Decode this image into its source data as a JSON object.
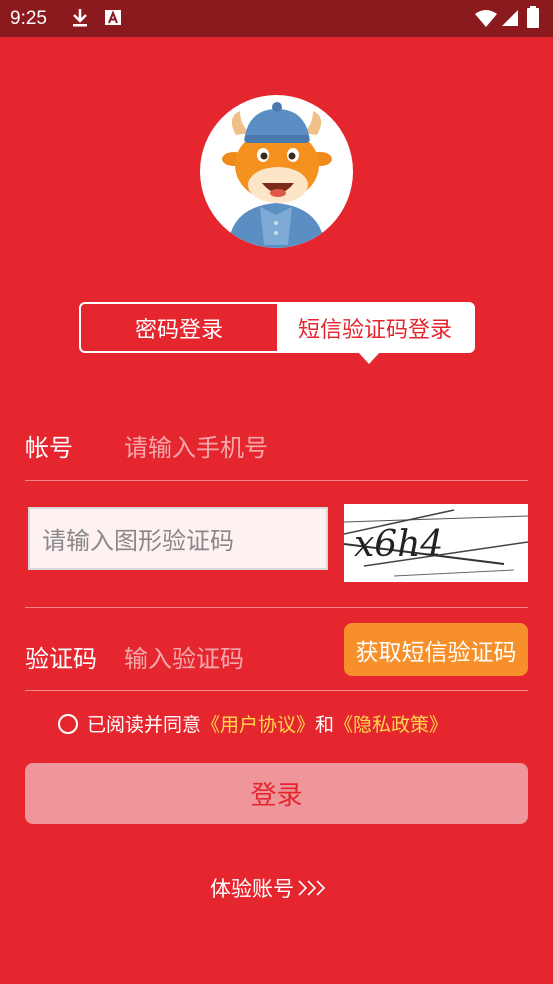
{
  "status": {
    "time": "9:25"
  },
  "tabs": {
    "password_login": "密码登录",
    "sms_login": "短信验证码登录"
  },
  "account": {
    "label": "帐号",
    "placeholder": "请输入手机号"
  },
  "captcha": {
    "placeholder": "请输入图形验证码",
    "image_text": "x6h4"
  },
  "sms_code": {
    "label": "验证码",
    "placeholder": "输入验证码",
    "get_button": "获取短信验证码"
  },
  "agreement": {
    "prefix": "已阅读并同意",
    "user_agreement": "《用户协议》",
    "and": "和",
    "privacy_policy": "《隐私政策》"
  },
  "login_button": "登录",
  "trial_account": "体验账号",
  "colors": {
    "background": "#e5262f",
    "status_bar": "#8b1a1f",
    "orange": "#f7902a",
    "link": "#ffd84a"
  }
}
